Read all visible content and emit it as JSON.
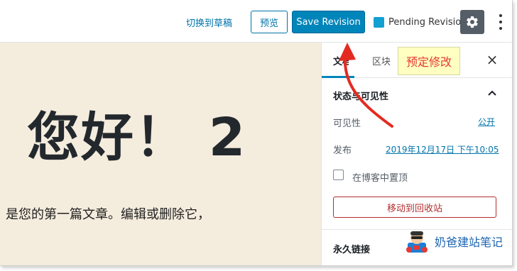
{
  "toolbar": {
    "switch_to_draft": "切换到草稿",
    "preview": "预览",
    "save_revision": "Save Revision",
    "pending_revision": "Pending Revision",
    "accent_color": "#0085ba"
  },
  "editor": {
    "title": "您好！ 2",
    "paragraph": "是您的第一篇文章。编辑或删除它，",
    "background_color": "#f4ecdd"
  },
  "sidebar": {
    "tabs": [
      {
        "label": "文档",
        "active": true
      },
      {
        "label": "区块",
        "active": false
      }
    ],
    "annotation": "预定修改",
    "panel_title": "状态与可见性",
    "visibility_label": "可见性",
    "visibility_value": "公开",
    "publish_label": "发布",
    "publish_value": "2019年12月17日 下午10:05",
    "sticky_label": "在博客中置顶",
    "trash_button": "移动到回收站",
    "permalink_title": "永久链接"
  },
  "watermark": {
    "text": "奶爸建站笔记"
  },
  "icons": [
    "gear-icon",
    "more-options-icon",
    "close-icon",
    "chevron-up-icon",
    "annotation-arrow",
    "mascot-logo"
  ]
}
